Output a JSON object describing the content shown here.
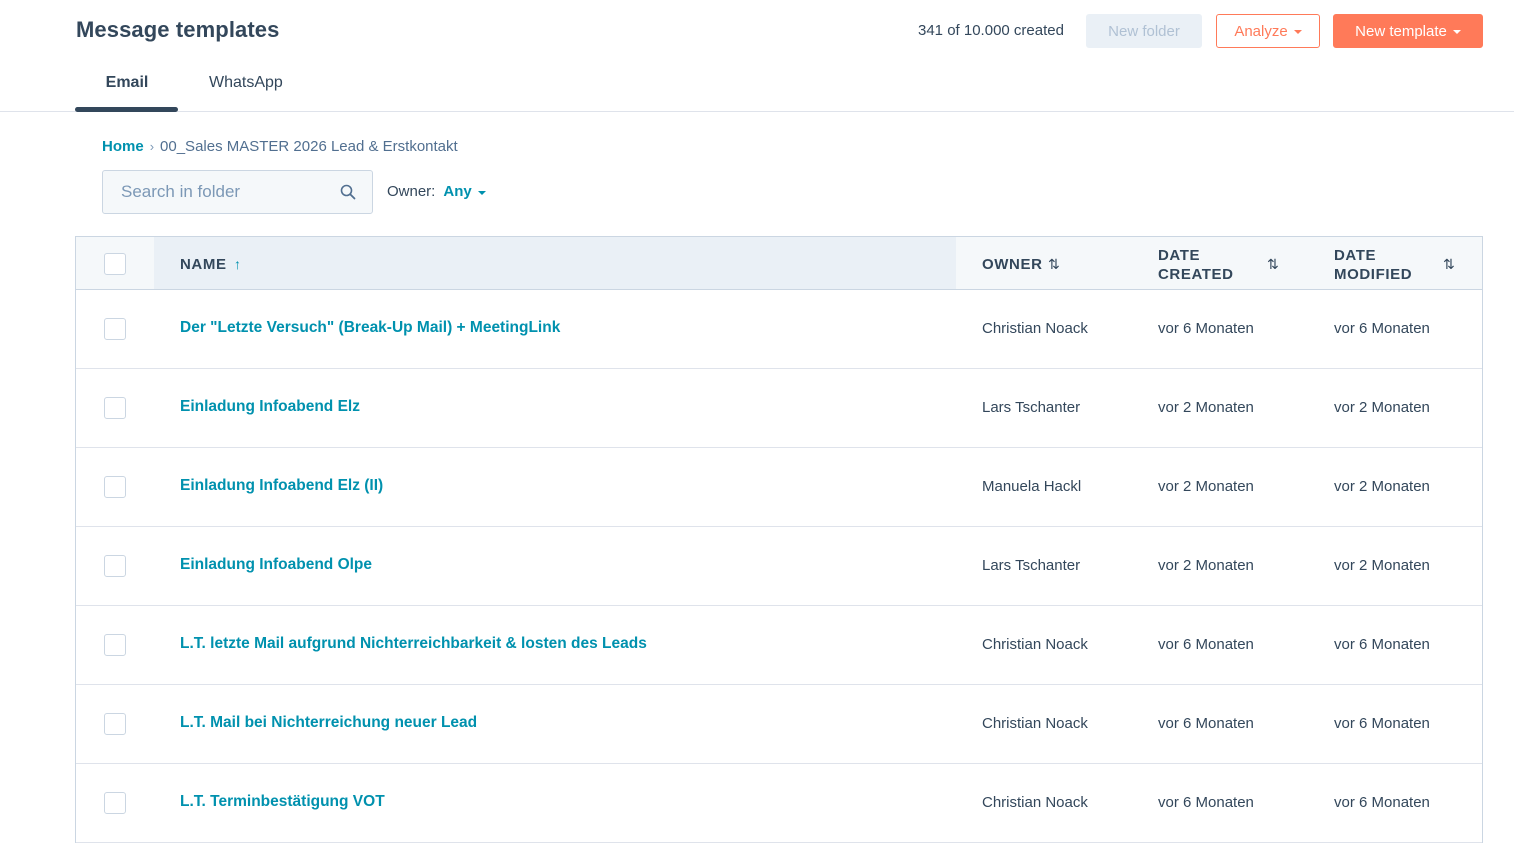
{
  "header": {
    "title": "Message templates",
    "counter": "341 of 10.000 created",
    "new_folder_label": "New folder",
    "analyze_label": "Analyze",
    "new_template_label": "New template"
  },
  "tabs": [
    {
      "label": "Email",
      "active": true
    },
    {
      "label": "WhatsApp",
      "active": false
    }
  ],
  "breadcrumb": {
    "home": "Home",
    "current": "00_Sales MASTER 2026 Lead & Erstkontakt"
  },
  "search": {
    "placeholder": "Search in folder",
    "value": ""
  },
  "filter": {
    "owner_label": "Owner:",
    "owner_value": "Any"
  },
  "table": {
    "columns": {
      "name": "NAME",
      "owner": "OWNER",
      "date_created_1": "DATE",
      "date_created_2": "CREATED",
      "date_modified_1": "DATE",
      "date_modified_2": "MODIFIED"
    },
    "sort_icons": {
      "name": "↑",
      "owner": "⇅",
      "date_created": "⇅",
      "date_modified": "⇅"
    },
    "rows": [
      {
        "name": "Der \"Letzte Versuch\" (Break-Up Mail) + MeetingLink",
        "owner": "Christian Noack",
        "created": "vor 6 Monaten",
        "modified": "vor 6 Monaten"
      },
      {
        "name": "Einladung Infoabend Elz",
        "owner": "Lars Tschanter",
        "created": "vor 2 Monaten",
        "modified": "vor 2 Monaten"
      },
      {
        "name": "Einladung Infoabend Elz (II)",
        "owner": "Manuela Hackl",
        "created": "vor 2 Monaten",
        "modified": "vor 2 Monaten"
      },
      {
        "name": "Einladung Infoabend Olpe",
        "owner": "Lars Tschanter",
        "created": "vor 2 Monaten",
        "modified": "vor 2 Monaten"
      },
      {
        "name": "L.T. letzte Mail aufgrund Nichterreichbarkeit & losten des Leads",
        "owner": "Christian Noack",
        "created": "vor 6 Monaten",
        "modified": "vor 6 Monaten"
      },
      {
        "name": "L.T. Mail bei Nichterreichung neuer Lead",
        "owner": "Christian Noack",
        "created": "vor 6 Monaten",
        "modified": "vor 6 Monaten"
      },
      {
        "name": "L.T. Terminbestätigung VOT",
        "owner": "Christian Noack",
        "created": "vor 6 Monaten",
        "modified": "vor 6 Monaten"
      }
    ]
  },
  "colors": {
    "accent": "#ff7a59",
    "link": "#0091ae",
    "text": "#33475b"
  }
}
